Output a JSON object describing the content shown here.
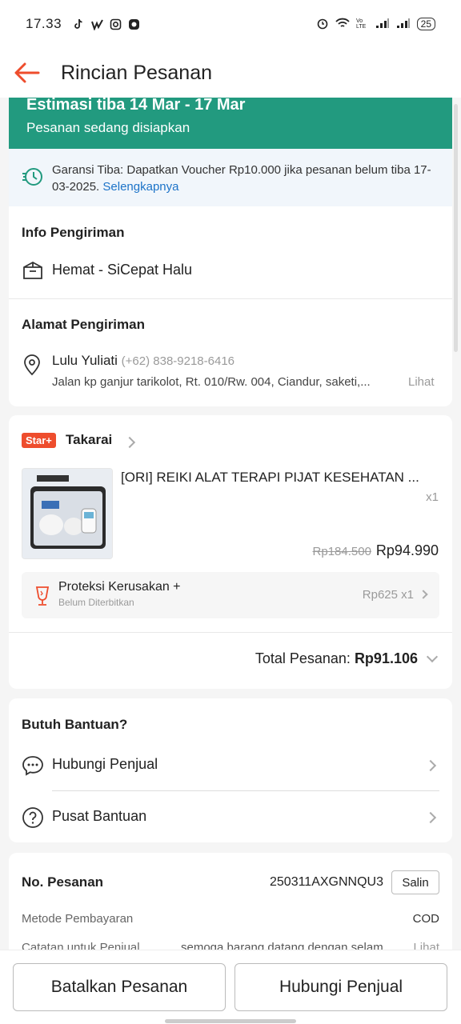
{
  "status_bar": {
    "time": "17.33",
    "battery": "25"
  },
  "header": {
    "title": "Rincian Pesanan"
  },
  "eta": {
    "title": "Estimasi tiba 14 Mar - 17 Mar",
    "subtitle": "Pesanan sedang disiapkan"
  },
  "guarantee": {
    "text": "Garansi Tiba: Dapatkan Voucher Rp10.000 jika pesanan belum tiba 17-03-2025.",
    "link": "Selengkapnya"
  },
  "shipping": {
    "section_title": "Info Pengiriman",
    "courier": "Hemat - SiCepat Halu"
  },
  "address": {
    "section_title": "Alamat Pengiriman",
    "name": "Lulu Yuliati",
    "phone": "(+62) 838-9218-6416",
    "street": "Jalan kp ganjur tarikolot, Rt. 010/Rw. 004, Ciandur, saketi,...",
    "see_more": "Lihat"
  },
  "shop": {
    "badge": "Star+",
    "name": "Takarai",
    "product": {
      "title": "[ORI] REIKI ALAT TERAPI PIJAT KESEHATAN ...",
      "qty": "x1",
      "original_price": "Rp184.500",
      "price": "Rp94.990"
    },
    "protection": {
      "title": "Proteksi Kerusakan +",
      "subtitle": "Belum Diterbitkan",
      "price": "Rp625 x1"
    },
    "total_label": "Total Pesanan:",
    "total_value": "Rp91.106"
  },
  "help": {
    "section_title": "Butuh Bantuan?",
    "contact_seller": "Hubungi Penjual",
    "help_center": "Pusat Bantuan"
  },
  "order": {
    "label": "No. Pesanan",
    "number": "250311AXGNNQU3",
    "copy_label": "Salin",
    "payment_label": "Metode Pembayaran",
    "payment_value": "COD",
    "note_label": "Catatan untuk Penjual",
    "note_value": "semoga barang datang dengan selam...",
    "note_more": "Lihat"
  },
  "actions": {
    "cancel": "Batalkan Pesanan",
    "contact": "Hubungi Penjual"
  },
  "colors": {
    "brand": "#ee4d2d",
    "eta_bg": "#229a7f",
    "link": "#1c73c8"
  }
}
